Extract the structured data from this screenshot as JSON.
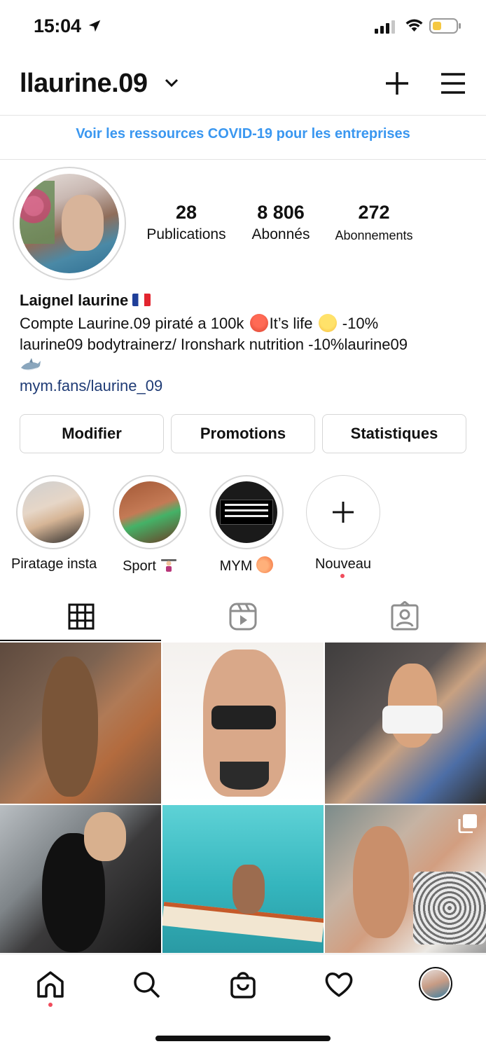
{
  "status_bar": {
    "time": "15:04"
  },
  "header": {
    "username": "llaurine.09"
  },
  "banner": {
    "link_text": "Voir les ressources COVID-19 pour les entreprises"
  },
  "profile": {
    "stats": [
      {
        "value": "28",
        "label": "Publications"
      },
      {
        "value": "8 806",
        "label": "Abonnés"
      },
      {
        "value": "272",
        "label": "Abonnements"
      }
    ],
    "name": "Laignel laurine",
    "bio_line1_a": "Compte Laurine.09 piraté a 100k",
    "bio_line1_b": "It’s life",
    "bio_line1_c": "-10%",
    "bio_line2": "laurine09 bodytrainerz/ Ironshark nutrition -10%laurine09",
    "link": "mym.fans/laurine_09"
  },
  "actions": {
    "edit": "Modifier",
    "promotions": "Promotions",
    "stats": "Statistiques"
  },
  "highlights": [
    {
      "label": "Piratage insta"
    },
    {
      "label": "Sport"
    },
    {
      "label": "MYM"
    },
    {
      "label": "Nouveau"
    }
  ],
  "icons": {
    "status": [
      "location-arrow-icon",
      "signal-icon",
      "wifi-icon",
      "battery-icon"
    ],
    "header": [
      "chevron-down-icon",
      "plus-icon",
      "menu-icon"
    ],
    "tabs": [
      "grid-icon",
      "reels-icon",
      "tagged-icon"
    ],
    "nav": [
      "home-icon",
      "search-icon",
      "shop-icon",
      "heart-icon",
      "profile-avatar"
    ]
  },
  "colors": {
    "link_blue": "#3a97f0",
    "bio_link": "#1f3b75",
    "notification_dot": "#f04c5c",
    "battery": "#f5c842"
  }
}
